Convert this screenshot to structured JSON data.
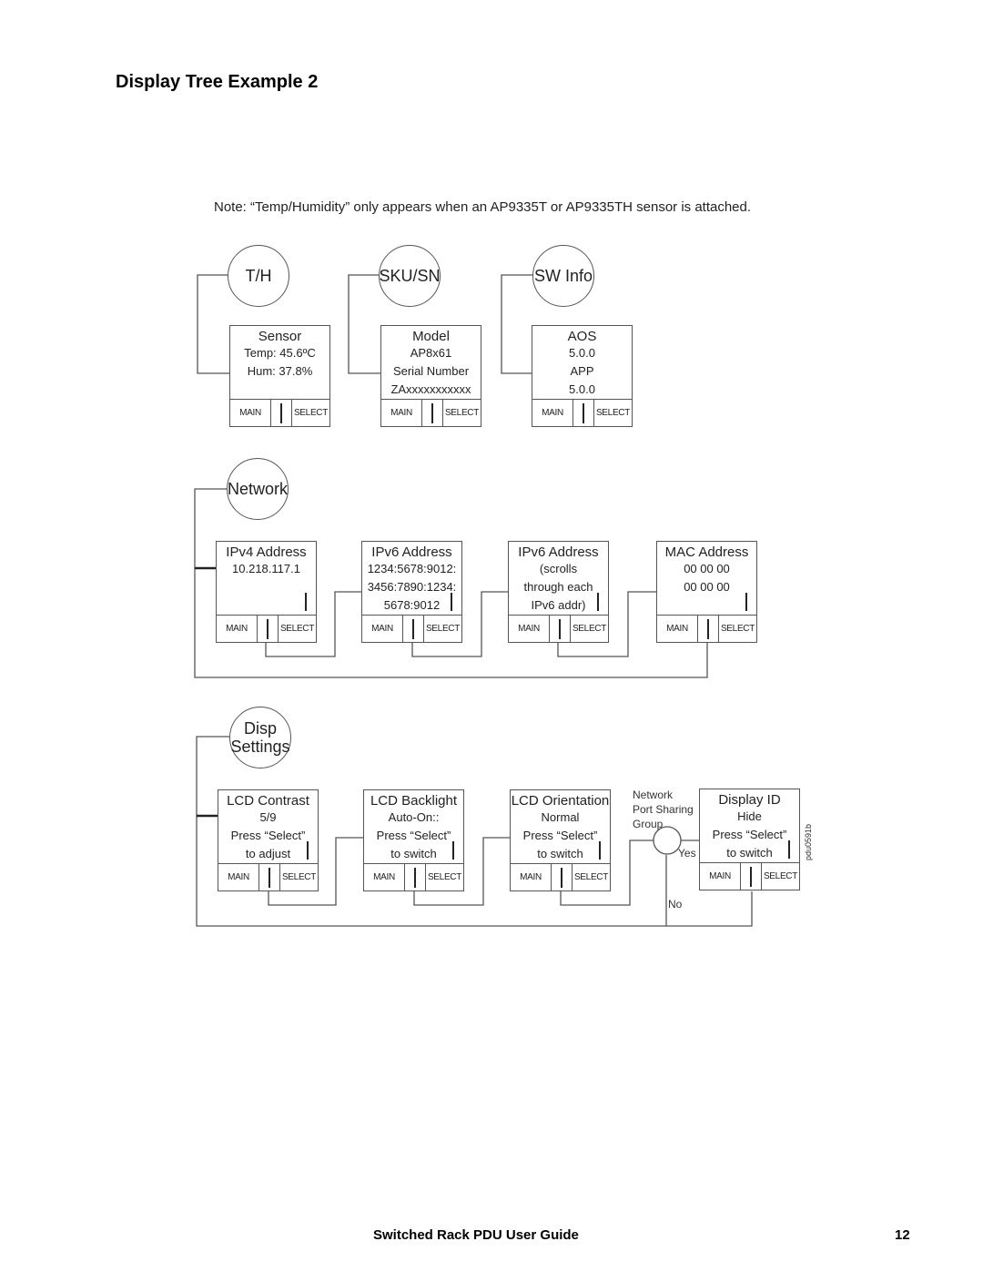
{
  "page": {
    "title": "Display Tree Example 2",
    "note": "Note:  “Temp/Humidity” only appears when an AP9335T or AP9335TH sensor is attached.",
    "footer_title": "Switched Rack PDU User Guide",
    "footer_page": "12",
    "figure_code": "pdu0591b"
  },
  "buttons": {
    "main": "MAIN",
    "select": "SELECT"
  },
  "nodes": {
    "th": "T/H",
    "sku": "SKU/SN",
    "sw": "SW Info",
    "network": "Network",
    "disp": "Disp\nSettings"
  },
  "screens": {
    "sensor": {
      "title": "Sensor",
      "lines": [
        "Temp: 45.6ºC",
        "Hum: 37.8%",
        ""
      ]
    },
    "model": {
      "title": "Model",
      "lines": [
        "AP8x61",
        "Serial Number",
        "ZAxxxxxxxxxxx"
      ]
    },
    "aos": {
      "title": "AOS",
      "lines": [
        "5.0.0",
        "APP",
        "5.0.0"
      ]
    },
    "ipv4": {
      "title": "IPv4  Address",
      "lines": [
        "10.218.117.1",
        "",
        ""
      ]
    },
    "ipv6a": {
      "title": "IPv6  Address",
      "lines": [
        "1234:5678:9012:",
        "3456:7890:1234:",
        "5678:9012"
      ]
    },
    "ipv6b": {
      "title": "IPv6  Address",
      "lines": [
        "(scrolls",
        "through each",
        "IPv6  addr)"
      ]
    },
    "mac": {
      "title": "MAC Address",
      "lines": [
        "00 00 00",
        "00 00 00",
        ""
      ]
    },
    "contrast": {
      "title": "LCD Contrast",
      "lines": [
        "5/9",
        "Press “Select”",
        "to adjust"
      ]
    },
    "backlight": {
      "title": "LCD Backlight",
      "lines": [
        "Auto-On::",
        "Press “Select”",
        "to switch"
      ]
    },
    "orientation": {
      "title": "LCD Orientation",
      "lines": [
        "Normal",
        "Press “Select”",
        "to switch"
      ]
    },
    "displayid": {
      "title": "Display ID",
      "lines": [
        "Hide",
        "Press “Select”",
        "to switch"
      ]
    }
  },
  "decision": {
    "label": "Network\nPort Sharing\nGroup",
    "yes": "Yes",
    "no": "No"
  }
}
